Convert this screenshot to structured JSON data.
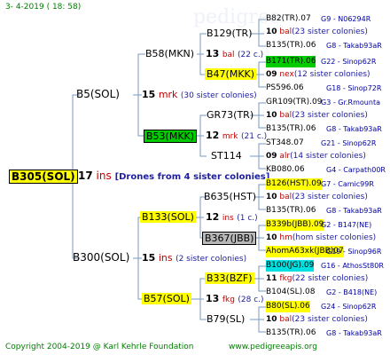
{
  "header": {
    "date": "3-  4-2019  ( 18:  58)"
  },
  "footer": {
    "copyright": "Copyright 2004-2019 @ Karl Kehrle Foundation",
    "website": "www.pedigreeapis.org"
  },
  "colors": {
    "line": "#7a9ac0",
    "yellow": "#ffff00",
    "green": "#00cc00",
    "gray": "#b8b8b8",
    "cyan": "#00e0e0",
    "title": "#008000"
  },
  "root": {
    "label": "B305(SOL)",
    "n": "17",
    "sp": "ins",
    "note": "[Drones from 4 sister colonies]"
  },
  "gen1": [
    {
      "label": "B5(SOL)",
      "n": "15",
      "sp": "mrk",
      "note": "(30 sister colonies)"
    },
    {
      "label": "B300(SOL)",
      "n": "15",
      "sp": "ins",
      "note": "(2 sister colonies)"
    }
  ],
  "gen2": [
    {
      "label": "B58(MKN)",
      "n": "13",
      "sp": "bal",
      "note": "(22 c.)"
    },
    {
      "label": "B53(MKK)",
      "n": "12",
      "sp": "mrk",
      "note": "(21 c.)"
    },
    {
      "label": "B133(SOL)",
      "n": "12",
      "sp": "ins",
      "note": "(1 c.)"
    },
    {
      "label": "B57(SOL)",
      "n": "13",
      "sp": "fkg",
      "note": "(28 c.)"
    }
  ],
  "gen3": [
    "B129(TR)",
    "B47(MKK)",
    "GR73(TR)",
    "ST114",
    "B635(HST)",
    "B367(JBB)",
    "B33(BZF)",
    "B79(SL)"
  ],
  "gen4": [
    {
      "top": {
        "label": "B82(TR).07",
        "info": "G9 - N06294R"
      },
      "mid": {
        "n": "10",
        "sp": "bal",
        "note": "(23 sister colonies)"
      },
      "bot": {
        "label": "B135(TR).06",
        "info": "G8 - Takab93aR"
      }
    },
    {
      "top": {
        "label": "B171(TR).06",
        "info": "G22 - Sinop62R"
      },
      "mid": {
        "n": "09",
        "sp": "nex",
        "note": "(12 sister colonies)"
      },
      "bot": {
        "label": "PS596.06",
        "info": "G18 - Sinop72R"
      }
    },
    {
      "top": {
        "label": "GR109(TR).09",
        "info": "G3 - Gr.Rmounta"
      },
      "mid": {
        "n": "10",
        "sp": "bal",
        "note": "(23 sister colonies)"
      },
      "bot": {
        "label": "B135(TR).06",
        "info": "G8 - Takab93aR"
      }
    },
    {
      "top": {
        "label": "ST348.07",
        "info": "G21 - Sinop62R"
      },
      "mid": {
        "n": "09",
        "sp": "alr",
        "note": "(14 sister colonies)"
      },
      "bot": {
        "label": "KB080.06",
        "info": "G4 - Carpath00R"
      }
    },
    {
      "top": {
        "label": "B126(HST).09",
        "info": "G7 - Camic99R"
      },
      "mid": {
        "n": "10",
        "sp": "bal",
        "note": "(23 sister colonies)"
      },
      "bot": {
        "label": "B135(TR).06",
        "info": "G8 - Takab93aR"
      }
    },
    {
      "top": {
        "label": "B339b(JBB).09",
        "info": "G2 - B147(NE)"
      },
      "mid": {
        "n": "10",
        "sp": "hm",
        "note": "(hom sister colonies)"
      },
      "bot": {
        "label": "AhomA63xk(JBB)07",
        "info": "G19 - Sinop96R"
      }
    },
    {
      "top": {
        "label": "B100(JG).09",
        "info": "G16 - AthosSt80R"
      },
      "mid": {
        "n": "11",
        "sp": "fkg",
        "note": "(22 sister colonies)"
      },
      "bot": {
        "label": "B104(SL).08",
        "info": "G2 - B418(NE)"
      }
    },
    {
      "top": {
        "label": "B80(SL).06",
        "info": "G24 - Sinop62R"
      },
      "mid": {
        "n": "10",
        "sp": "bal",
        "note": "(23 sister colonies)"
      },
      "bot": {
        "label": "B135(TR).06",
        "info": "G8 - Takab93aR"
      }
    }
  ]
}
